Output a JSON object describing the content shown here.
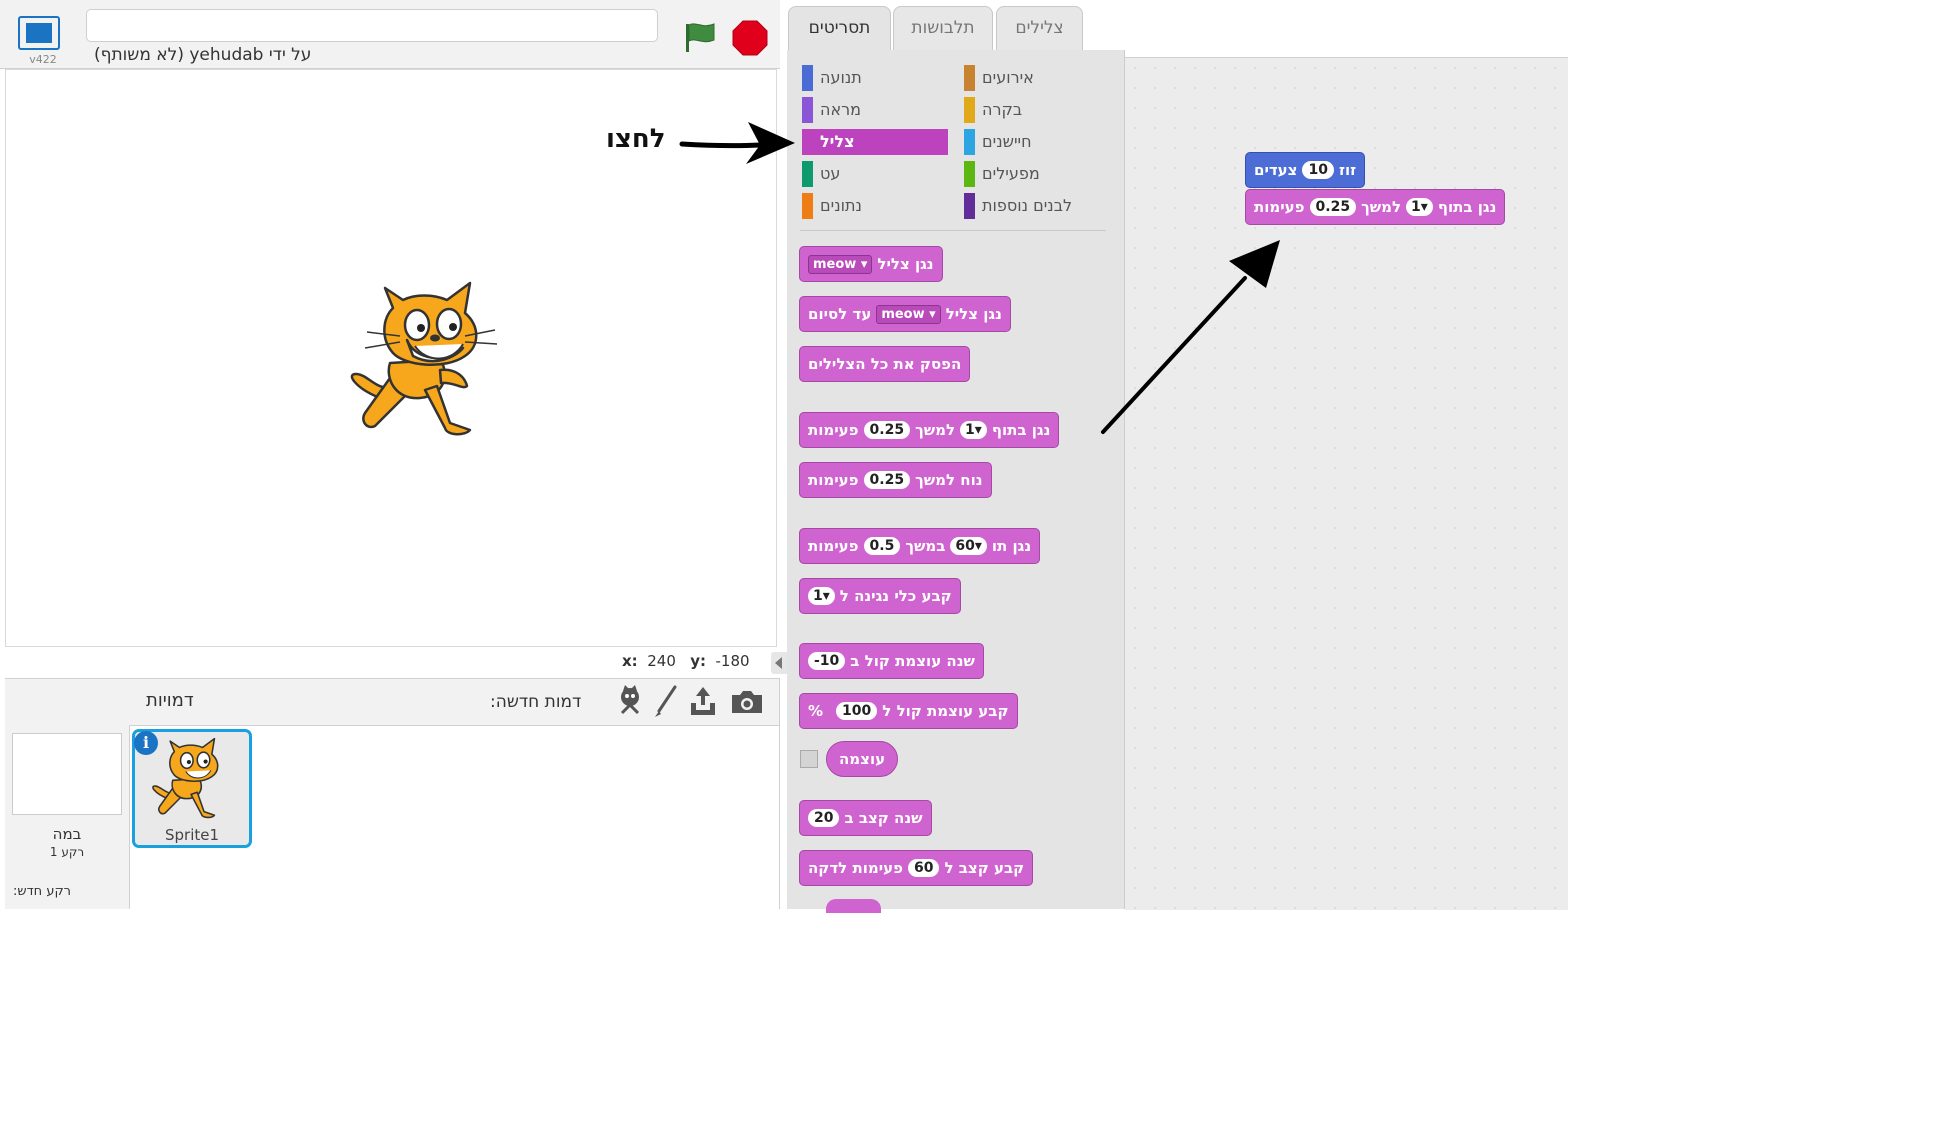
{
  "stage_header": {
    "version": "v422",
    "title_value": "",
    "byline": "על ידי yehudab (לא משותף)"
  },
  "coords": {
    "x_label": "x:",
    "x_value": "240",
    "y_label": "y:",
    "y_value": "-180"
  },
  "sprite_pane": {
    "title": "דמויות",
    "new_sprite_label": "דמות חדשה:",
    "stage_label": "במה",
    "backdrop_count": "רקע 1",
    "new_backdrop_label": "רקע חדש:",
    "sprites": [
      {
        "name": "Sprite1"
      }
    ]
  },
  "tabs": {
    "scripts": "תסריטים",
    "costumes": "תלבושות",
    "sounds": "צלילים"
  },
  "categories": [
    {
      "label": "תנועה",
      "color": "#4a6cd4"
    },
    {
      "label": "מראה",
      "color": "#8a55d7"
    },
    {
      "label": "צליל",
      "color": "#bb42c3",
      "active": true
    },
    {
      "label": "עט",
      "color": "#0e9a6c"
    },
    {
      "label": "נתונים",
      "color": "#ee7d16"
    },
    {
      "label": "אירועים",
      "color": "#c88330"
    },
    {
      "label": "בקרה",
      "color": "#e1a91a"
    },
    {
      "label": "חיישנים",
      "color": "#2ca5e2"
    },
    {
      "label": "מפעילים",
      "color": "#5cb712"
    },
    {
      "label": "לבנים נוספות",
      "color": "#632d99"
    }
  ],
  "blocks": {
    "play_sound": {
      "text": "נגן צליל",
      "value": "meow"
    },
    "play_sound_until_done": {
      "text1": "נגן צליל",
      "value": "meow",
      "text2": "עד לסיום"
    },
    "stop_all_sounds": {
      "text": "הפסק את כל הצלילים"
    },
    "play_drum": {
      "text1": "נגן בתוף",
      "drum": "1",
      "text2": "למשך",
      "beats": "0.25",
      "text3": "פעימות"
    },
    "rest": {
      "text1": "נוח למשך",
      "beats": "0.25",
      "text2": "פעימות"
    },
    "play_note": {
      "text1": "נגן תו",
      "note": "60",
      "text2": "במשך",
      "beats": "0.5",
      "text3": "פעימות"
    },
    "set_instrument": {
      "text": "קבע כלי נגינה ל",
      "value": "1"
    },
    "change_volume": {
      "text": "שנה עוצמת קול ב",
      "value": "-10"
    },
    "set_volume": {
      "text": "קבע עוצמת קול ל",
      "value": "100",
      "unit": "%"
    },
    "volume_reporter": {
      "text": "עוצמה"
    },
    "change_tempo": {
      "text": "שנה קצב ב",
      "value": "20"
    },
    "set_tempo": {
      "text1": "קבע קצב ל",
      "value": "60",
      "text2": "פעימות לדקה"
    }
  },
  "script": {
    "move": {
      "text1": "זוז",
      "value": "10",
      "text2": "צעדים"
    },
    "drum": {
      "text1": "נגן בתוף",
      "drum": "1",
      "text2": "למשך",
      "beats": "0.25",
      "text3": "פעימות"
    }
  },
  "annotation": {
    "hint": "לחצו"
  },
  "colors": {
    "sound": "#cf63cf",
    "motion": "#4c6cd6",
    "selection": "#1aa0de",
    "stop": "#e0001b",
    "flag": "#3f8b3f"
  }
}
